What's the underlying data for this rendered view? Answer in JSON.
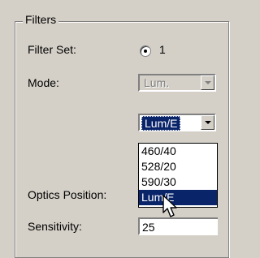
{
  "group": {
    "title": "Filters"
  },
  "filter_set": {
    "label": "Filter Set:",
    "radio_label": "1",
    "checked": true
  },
  "mode": {
    "label": "Mode:",
    "value": "Lum.",
    "enabled": false
  },
  "filter_dropdown": {
    "value": "Lum/E",
    "options": [
      "460/40",
      "528/20",
      "590/30",
      "Lum/E"
    ],
    "selected": "Lum/E"
  },
  "optics": {
    "label": "Optics Position:"
  },
  "sensitivity": {
    "label": "Sensitivity:",
    "value": "25"
  },
  "icons": {
    "dropdown": "chevron-down-icon",
    "pointer": "mouse-cursor-icon"
  },
  "colors": {
    "selection": "#0a246a",
    "window_bg": "#d4d0c8"
  }
}
